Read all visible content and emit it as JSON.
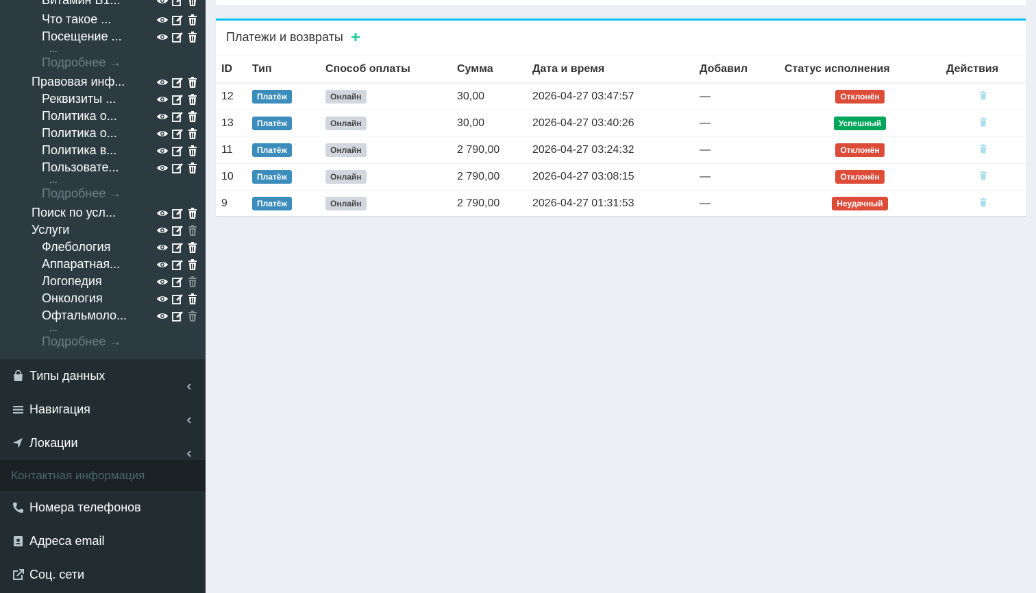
{
  "sidebar": {
    "tree": [
      {
        "label": "Витамин В1...",
        "indent": 2
      },
      {
        "label": "Что такое ...",
        "indent": 2
      },
      {
        "label": "Посещение ...",
        "indent": 2
      },
      {
        "label": "Правовая инф...",
        "indent": 1
      },
      {
        "label": "Реквизиты ...",
        "indent": 2
      },
      {
        "label": "Политика о...",
        "indent": 2
      },
      {
        "label": "Политика о...",
        "indent": 2
      },
      {
        "label": "Политика в...",
        "indent": 2
      },
      {
        "label": "Пользовате...",
        "indent": 2
      },
      {
        "label": "Поиск по усл...",
        "indent": 1
      },
      {
        "label": "Услуги",
        "indent": 1
      },
      {
        "label": "Флебология",
        "indent": 2
      },
      {
        "label": "Аппаратная...",
        "indent": 2
      },
      {
        "label": "Логопедия",
        "indent": 2
      },
      {
        "label": "Онкология",
        "indent": 2
      },
      {
        "label": "Офтальмоло...",
        "indent": 2
      }
    ],
    "more_label": "Подробнее →",
    "dots": "...",
    "menu": {
      "data_types": "Типы данных",
      "navigation": "Навигация",
      "locations": "Локации",
      "contact_header": "Контактная информация",
      "phones": "Номера телефонов",
      "emails": "Адреса email",
      "social": "Соц. сети"
    },
    "icons": [
      "eye-icon",
      "edit-icon",
      "trash-icon",
      "shopping-bag-icon",
      "bars-icon",
      "location-arrow-icon",
      "phone-icon",
      "address-book-icon",
      "external-link-icon",
      "chevron-left-icon"
    ]
  },
  "main": {
    "title": "Платежи и возвраты",
    "columns": [
      "ID",
      "Тип",
      "Способ оплаты",
      "Сумма",
      "Дата и время",
      "Добавил",
      "Статус исполнения",
      "Действия"
    ],
    "rows": [
      {
        "id": "12",
        "type": "Платёж",
        "method": "Онлайн",
        "amount": "30,00",
        "datetime": "2026-04-27 03:47:57",
        "added_by": "—",
        "status": "Отклонён",
        "status_color": "#dd4b39"
      },
      {
        "id": "13",
        "type": "Платёж",
        "method": "Онлайн",
        "amount": "30,00",
        "datetime": "2026-04-27 03:40:26",
        "added_by": "—",
        "status": "Успешный",
        "status_color": "#00a65a"
      },
      {
        "id": "11",
        "type": "Платёж",
        "method": "Онлайн",
        "amount": "2 790,00",
        "datetime": "2026-04-27 03:24:32",
        "added_by": "—",
        "status": "Отклонён",
        "status_color": "#dd4b39"
      },
      {
        "id": "10",
        "type": "Платёж",
        "method": "Онлайн",
        "amount": "2 790,00",
        "datetime": "2026-04-27 03:08:15",
        "added_by": "—",
        "status": "Отклонён",
        "status_color": "#dd4b39"
      },
      {
        "id": "9",
        "type": "Платёж",
        "method": "Онлайн",
        "amount": "2 790,00",
        "datetime": "2026-04-27 01:31:53",
        "added_by": "—",
        "status": "Неудачный",
        "status_color": "#dd4b39"
      }
    ],
    "colors": {
      "accent": "#00c0ef",
      "type_label": "#3c8dbc",
      "method_label": "#d2d6de",
      "add_icon": "#00a65a"
    }
  }
}
